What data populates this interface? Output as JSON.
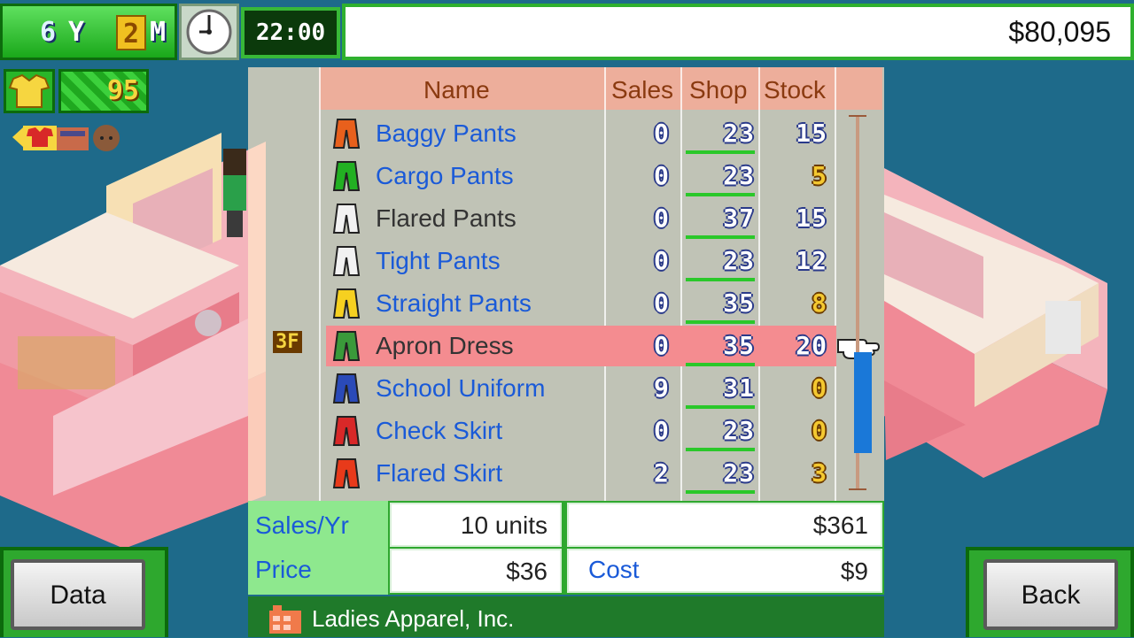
{
  "header": {
    "year_value": "6",
    "year_unit": "Y",
    "month_value": "2",
    "month_unit": "M",
    "time": "22:00",
    "money": "$80,095"
  },
  "status": {
    "score": "95"
  },
  "table": {
    "headers": {
      "name": "Name",
      "sales": "Sales",
      "shop": "Shop",
      "stock": "Stock"
    },
    "floor_tag": "3F",
    "rows": [
      {
        "name": "Baggy Pants",
        "sales": "0",
        "shop": "23",
        "stock": "15",
        "icon": "baggy-pants-icon",
        "icon_color": "#e8601c"
      },
      {
        "name": "Cargo Pants",
        "sales": "0",
        "shop": "23",
        "stock": "5",
        "icon": "cargo-pants-icon",
        "icon_color": "#22b022"
      },
      {
        "name": "Flared Pants",
        "sales": "0",
        "shop": "37",
        "stock": "15",
        "icon": "flared-pants-icon",
        "icon_color": "#f2f2f2"
      },
      {
        "name": "Tight Pants",
        "sales": "0",
        "shop": "23",
        "stock": "12",
        "icon": "tight-pants-icon",
        "icon_color": "#f2f2f2"
      },
      {
        "name": "Straight Pants",
        "sales": "0",
        "shop": "35",
        "stock": "8",
        "icon": "straight-pants-icon",
        "icon_color": "#f6d020"
      },
      {
        "name": "Apron Dress",
        "sales": "0",
        "shop": "35",
        "stock": "20",
        "icon": "apron-dress-icon",
        "icon_color": "#3a9a3a"
      },
      {
        "name": "School Uniform",
        "sales": "9",
        "shop": "31",
        "stock": "0",
        "icon": "school-uniform-icon",
        "icon_color": "#2a4ab8"
      },
      {
        "name": "Check Skirt",
        "sales": "0",
        "shop": "23",
        "stock": "0",
        "icon": "check-skirt-icon",
        "icon_color": "#d82828"
      },
      {
        "name": "Flared Skirt",
        "sales": "2",
        "shop": "23",
        "stock": "3",
        "icon": "flared-skirt-icon",
        "icon_color": "#e83a1a"
      }
    ]
  },
  "stats": {
    "sales_yr_label": "Sales/Yr",
    "sales_yr_value": "10  units",
    "revenue_value": "$361",
    "price_label": "Price",
    "price_value": "$36",
    "cost_label": "Cost",
    "cost_value": "$9"
  },
  "company": {
    "name": "Ladies Apparel, Inc."
  },
  "buttons": {
    "data": "Data",
    "back": "Back"
  },
  "colors": {
    "accent_green": "#2ea82e",
    "selected_row": "#f48c90",
    "link_blue": "#1a5ad8",
    "scroll_thumb": "#1a78d8"
  }
}
